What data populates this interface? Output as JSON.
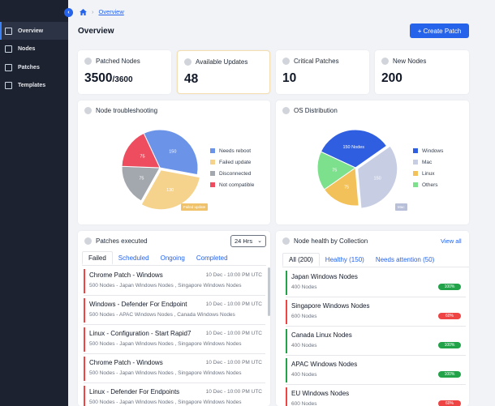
{
  "sidebar": {
    "items": [
      {
        "label": "Overview",
        "icon": "grid-icon"
      },
      {
        "label": "Nodes",
        "icon": "nodes-icon"
      },
      {
        "label": "Patches",
        "icon": "patches-icon"
      },
      {
        "label": "Templates",
        "icon": "templates-icon"
      }
    ]
  },
  "breadcrumb": {
    "current": "Overview"
  },
  "header": {
    "title": "Overview",
    "create_label": "+ Create Patch"
  },
  "stats": [
    {
      "label": "Patched Nodes",
      "value": "3500",
      "total": "/3600"
    },
    {
      "label": "Available Updates",
      "value": "48"
    },
    {
      "label": "Critical Patches",
      "value": "10"
    },
    {
      "label": "New Nodes",
      "value": "200"
    }
  ],
  "node_troubleshooting": {
    "title": "Node troubleshooting",
    "legend": [
      "Needs reboot",
      "Failed update",
      "Disconnected",
      "Not compatible"
    ],
    "colors": [
      "#6b93e8",
      "#f5d38c",
      "#a3a7ae",
      "#ee4d5f"
    ],
    "slice_labels": [
      "150",
      "130",
      "75",
      "75"
    ],
    "tooltip": "Failed update"
  },
  "os_distribution": {
    "title": "OS Distribution",
    "legend": [
      "Windows",
      "Mac",
      "Linux",
      "Others"
    ],
    "colors": [
      "#2f5fe0",
      "#c7cde3",
      "#f2c15a",
      "#7de08c"
    ],
    "slice_labels": [
      "150 Nodes",
      "150",
      "75",
      "75"
    ],
    "tooltip": "Mac"
  },
  "chart_data": [
    {
      "type": "pie",
      "title": "Node troubleshooting",
      "categories": [
        "Needs reboot",
        "Failed update",
        "Disconnected",
        "Not compatible"
      ],
      "values": [
        150,
        130,
        75,
        75
      ]
    },
    {
      "type": "pie",
      "title": "OS Distribution",
      "categories": [
        "Windows",
        "Mac",
        "Linux",
        "Others"
      ],
      "values": [
        150,
        150,
        75,
        75
      ]
    }
  ],
  "patches": {
    "title": "Patches executed",
    "range": "24 Hrs",
    "tabs": [
      "Failed",
      "Scheduled",
      "Ongoing",
      "Completed"
    ],
    "items": [
      {
        "title": "Chrome Patch - Windows",
        "date": "10 Dec - 10:00 PM UTC",
        "sub": "500 Nodes - Japan Windows Nodes , Singapore Windows Nodes"
      },
      {
        "title": "Windows - Defender For Endpoint",
        "date": "10 Dec - 10:00 PM UTC",
        "sub": "500 Nodes - APAC Windows Nodes , Canada Windows Nodes"
      },
      {
        "title": "Linux - Configuration - Start Rapid7",
        "date": "10 Dec - 10:00 PM UTC",
        "sub": "500 Nodes - Japan Windows Nodes , Singapore Windows Nodes"
      },
      {
        "title": "Chrome Patch - Windows",
        "date": "10 Dec - 10:00 PM UTC",
        "sub": "500 Nodes - Japan Windows Nodes , Singapore Windows Nodes"
      },
      {
        "title": "Linux - Defender For Endpoints",
        "date": "10 Dec - 10:00 PM UTC",
        "sub": "500 Nodes - Japan Windows Nodes , Singapore Windows Nodes"
      }
    ]
  },
  "health": {
    "title": "Node health by Collection",
    "view_all": "View all",
    "tabs": [
      "All (200)",
      "Healthy (150)",
      "Needs attention (50)"
    ],
    "items": [
      {
        "title": "Japan Windows Nodes",
        "sub": "400 Nodes",
        "pct": "100%",
        "color": "#22a34a"
      },
      {
        "title": "Singapore Windows Nodes",
        "sub": "600 Nodes",
        "pct": "60%",
        "color": "#ef4444"
      },
      {
        "title": "Canada Linux Nodes",
        "sub": "400 Nodes",
        "pct": "100%",
        "color": "#22a34a"
      },
      {
        "title": "APAC Windows Nodes",
        "sub": "400 Nodes",
        "pct": "100%",
        "color": "#22a34a"
      },
      {
        "title": "EU Windows Nodes",
        "sub": "600 Nodes",
        "pct": "60%",
        "color": "#ef4444"
      }
    ]
  }
}
